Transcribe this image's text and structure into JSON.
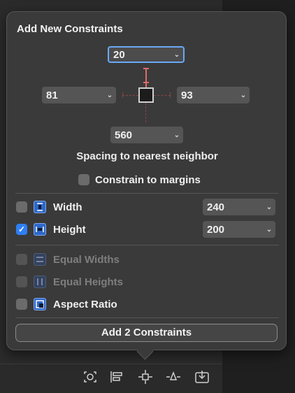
{
  "popover": {
    "title": "Add New Constraints",
    "spacing": {
      "top": "20",
      "left": "81",
      "right": "93",
      "bottom": "560",
      "caption": "Spacing to nearest neighbor"
    },
    "margins": {
      "label": "Constrain to margins",
      "checked": false
    },
    "size_rows": [
      {
        "label": "Width",
        "value": "240",
        "checked": false
      },
      {
        "label": "Height",
        "value": "200",
        "checked": true
      }
    ],
    "option_rows": [
      {
        "label": "Equal Widths",
        "enabled": false
      },
      {
        "label": "Equal Heights",
        "enabled": false
      },
      {
        "label": "Aspect Ratio",
        "enabled": true
      }
    ],
    "add_button": "Add 2 Constraints"
  },
  "toolbar": {
    "icons": [
      "update-frames-icon",
      "align-icon",
      "add-constraints-icon",
      "resolve-issues-icon",
      "embed-in-icon"
    ]
  },
  "colors": {
    "accent": "#2f7ff3",
    "focus_ring": "#6aa9f5",
    "strut": "#e06a6a",
    "popover_bg": "#3a3a3b"
  }
}
